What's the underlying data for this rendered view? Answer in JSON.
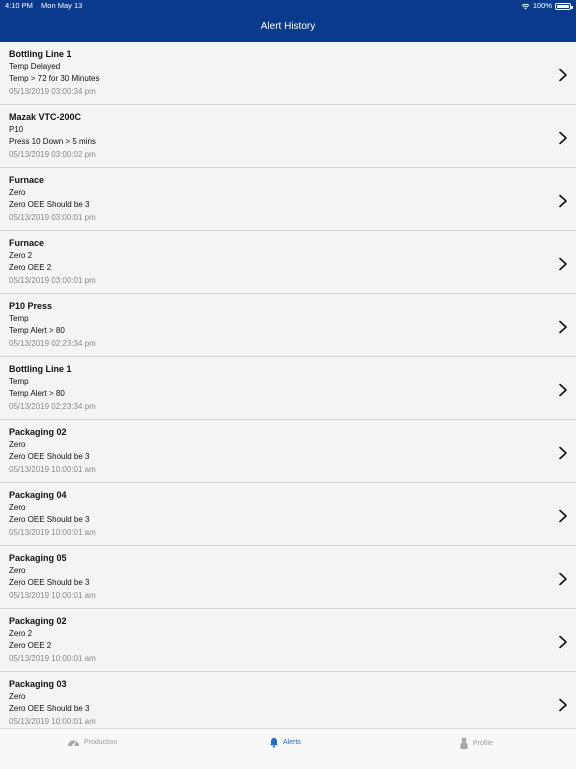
{
  "status_bar": {
    "time": "4:10 PM",
    "date": "Mon May 13",
    "battery": "100%"
  },
  "header": {
    "title": "Alert History"
  },
  "alerts": [
    {
      "title": "Bottling Line 1",
      "line1": "Temp Delayed",
      "line2": "Temp > 72 for 30 Minutes",
      "time": "05/13/2019 03:00:34 pm"
    },
    {
      "title": "Mazak VTC-200C",
      "line1": "P10",
      "line2": "Press 10 Down > 5 mins",
      "time": "05/13/2019 03:00:02 pm"
    },
    {
      "title": "Furnace",
      "line1": "Zero",
      "line2": "Zero OEE Should be 3",
      "time": "05/13/2019 03:00:01 pm"
    },
    {
      "title": "Furnace",
      "line1": "Zero 2",
      "line2": "Zero OEE 2",
      "time": "05/13/2019 03:00:01 pm"
    },
    {
      "title": "P10 Press",
      "line1": "Temp",
      "line2": "Temp Alert > 80",
      "time": "05/13/2019 02:23:34 pm"
    },
    {
      "title": "Bottling Line 1",
      "line1": "Temp",
      "line2": "Temp Alert > 80",
      "time": "05/13/2019 02:23:34 pm"
    },
    {
      "title": "Packaging 02",
      "line1": "Zero",
      "line2": "Zero OEE Should be 3",
      "time": "05/13/2019 10:00:01 am"
    },
    {
      "title": "Packaging 04",
      "line1": "Zero",
      "line2": "Zero OEE Should be 3",
      "time": "05/13/2019 10:00:01 am"
    },
    {
      "title": "Packaging 05",
      "line1": "Zero",
      "line2": "Zero OEE Should be 3",
      "time": "05/13/2019 10:00:01 am"
    },
    {
      "title": "Packaging 02",
      "line1": "Zero 2",
      "line2": "Zero OEE 2",
      "time": "05/13/2019 10:00:01 am"
    },
    {
      "title": "Packaging 03",
      "line1": "Zero",
      "line2": "Zero OEE Should be 3",
      "time": "05/13/2019 10:00:01 am"
    }
  ],
  "tabs": [
    {
      "label": "Production",
      "icon": "production-icon",
      "active": false
    },
    {
      "label": "Alerts",
      "icon": "bell-icon",
      "active": true
    },
    {
      "label": "Profile",
      "icon": "person-icon",
      "active": false
    }
  ],
  "colors": {
    "header": "#0a3a8c",
    "active_tab": "#1a6fd6",
    "inactive_tab": "#9a9a9a"
  }
}
